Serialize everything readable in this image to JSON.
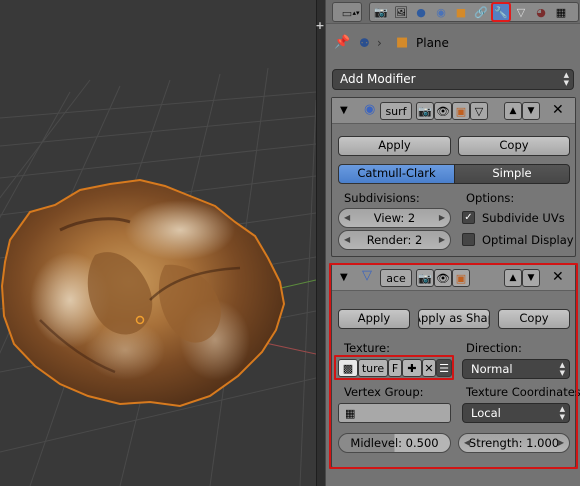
{
  "toolbar": {
    "icons": [
      "render-icon",
      "render-layers-icon",
      "scene-icon",
      "world-icon",
      "object-icon",
      "constraints-icon",
      "modifiers-icon",
      "data-icon",
      "material-icon",
      "texture-icon"
    ],
    "active": "modifiers-icon"
  },
  "context": {
    "object_name": "Plane"
  },
  "add_modifier": {
    "label": "Add Modifier"
  },
  "subsurf": {
    "name_field": "surf",
    "apply_label": "Apply",
    "copy_label": "Copy",
    "tab_catmull": "Catmull-Clark",
    "tab_simple": "Simple",
    "active_tab": "Catmull-Clark",
    "subdivisions_label": "Subdivisions:",
    "options_label": "Options:",
    "view_field": "View: 2",
    "render_field": "Render: 2",
    "subdivide_uvs": {
      "label": "Subdivide UVs",
      "checked": true
    },
    "optimal_display": {
      "label": "Optimal Display",
      "checked": false
    }
  },
  "displace": {
    "name_field": "ace",
    "apply_label": "Apply",
    "apply_shape_label": "Apply as Shap",
    "copy_label": "Copy",
    "texture_label": "Texture:",
    "texture_value": "ture",
    "texture_f": "F",
    "direction_label": "Direction:",
    "direction_value": "Normal",
    "vertex_group_label": "Vertex Group:",
    "texcoords_label": "Texture Coordinates:",
    "texcoords_value": "Local",
    "midlevel_field": "Midlevel: 0.500",
    "strength_field": "Strength: 1.000"
  },
  "colors": {
    "highlight_red": "#d21414",
    "active_blue": "#5680c2",
    "viewport_bg": "#393939",
    "grid": "#4a4a4a"
  }
}
